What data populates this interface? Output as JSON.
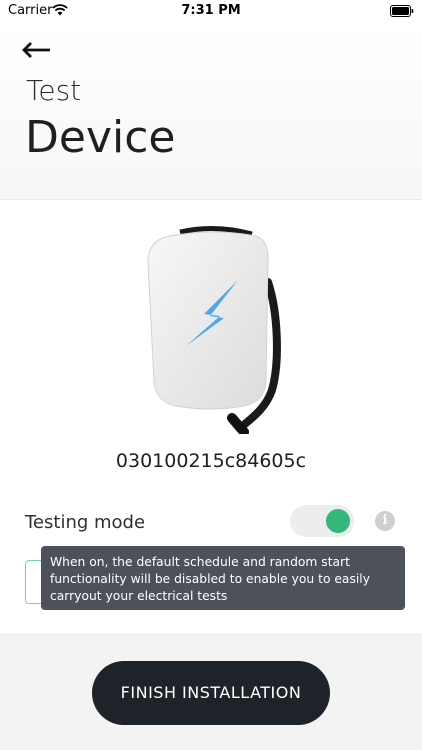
{
  "status_bar": {
    "carrier": "Carrier",
    "time": "7:31 PM"
  },
  "header": {
    "back_icon": "arrow-left-icon",
    "title_small": "Test",
    "title_large": "Device"
  },
  "device": {
    "serial": "030100215c84605c",
    "accent_color": "#4aa8ea"
  },
  "testing_mode": {
    "label": "Testing mode",
    "enabled": true,
    "toggle_color": "#34b87a",
    "info_icon": "info-icon",
    "info_glyph": "i",
    "tooltip": "When on, the default schedule and random start functionality will be disabled to enable you to easily carryout your electrical tests"
  },
  "footer": {
    "finish_label": "FINISH INSTALLATION"
  }
}
